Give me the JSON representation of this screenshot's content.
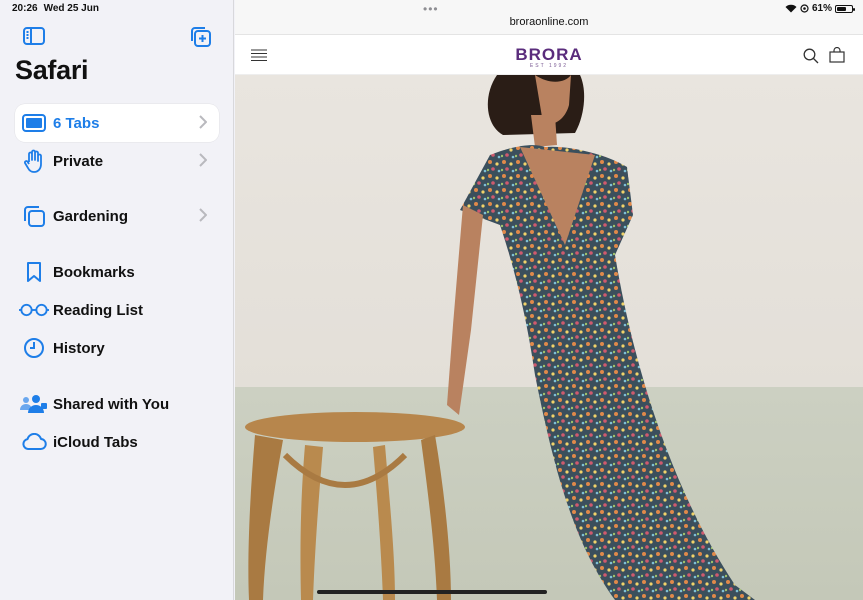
{
  "status": {
    "time": "20:26",
    "date": "Wed 25 Jun",
    "battery_pct": "61%",
    "battery_fraction": 0.61
  },
  "sidebar": {
    "title": "Safari",
    "items": [
      {
        "label": "6 Tabs",
        "icon": "tablet-icon",
        "selected": true,
        "chevron": true
      },
      {
        "label": "Private",
        "icon": "hand-icon",
        "chevron": true
      },
      {
        "label": "Gardening",
        "icon": "tab-group-icon",
        "chevron": true
      },
      {
        "label": "Bookmarks",
        "icon": "bookmark-icon"
      },
      {
        "label": "Reading List",
        "icon": "glasses-icon"
      },
      {
        "label": "History",
        "icon": "clock-icon"
      },
      {
        "label": "Shared with You",
        "icon": "shared-people-icon"
      },
      {
        "label": "iCloud Tabs",
        "icon": "cloud-icon"
      }
    ]
  },
  "browser": {
    "url": "broraonline.com",
    "site_logo": "BRORA",
    "site_logo_sub": "EST 1992",
    "brand_color": "#5a2c7c",
    "accent_color": "#1e7ee8"
  }
}
